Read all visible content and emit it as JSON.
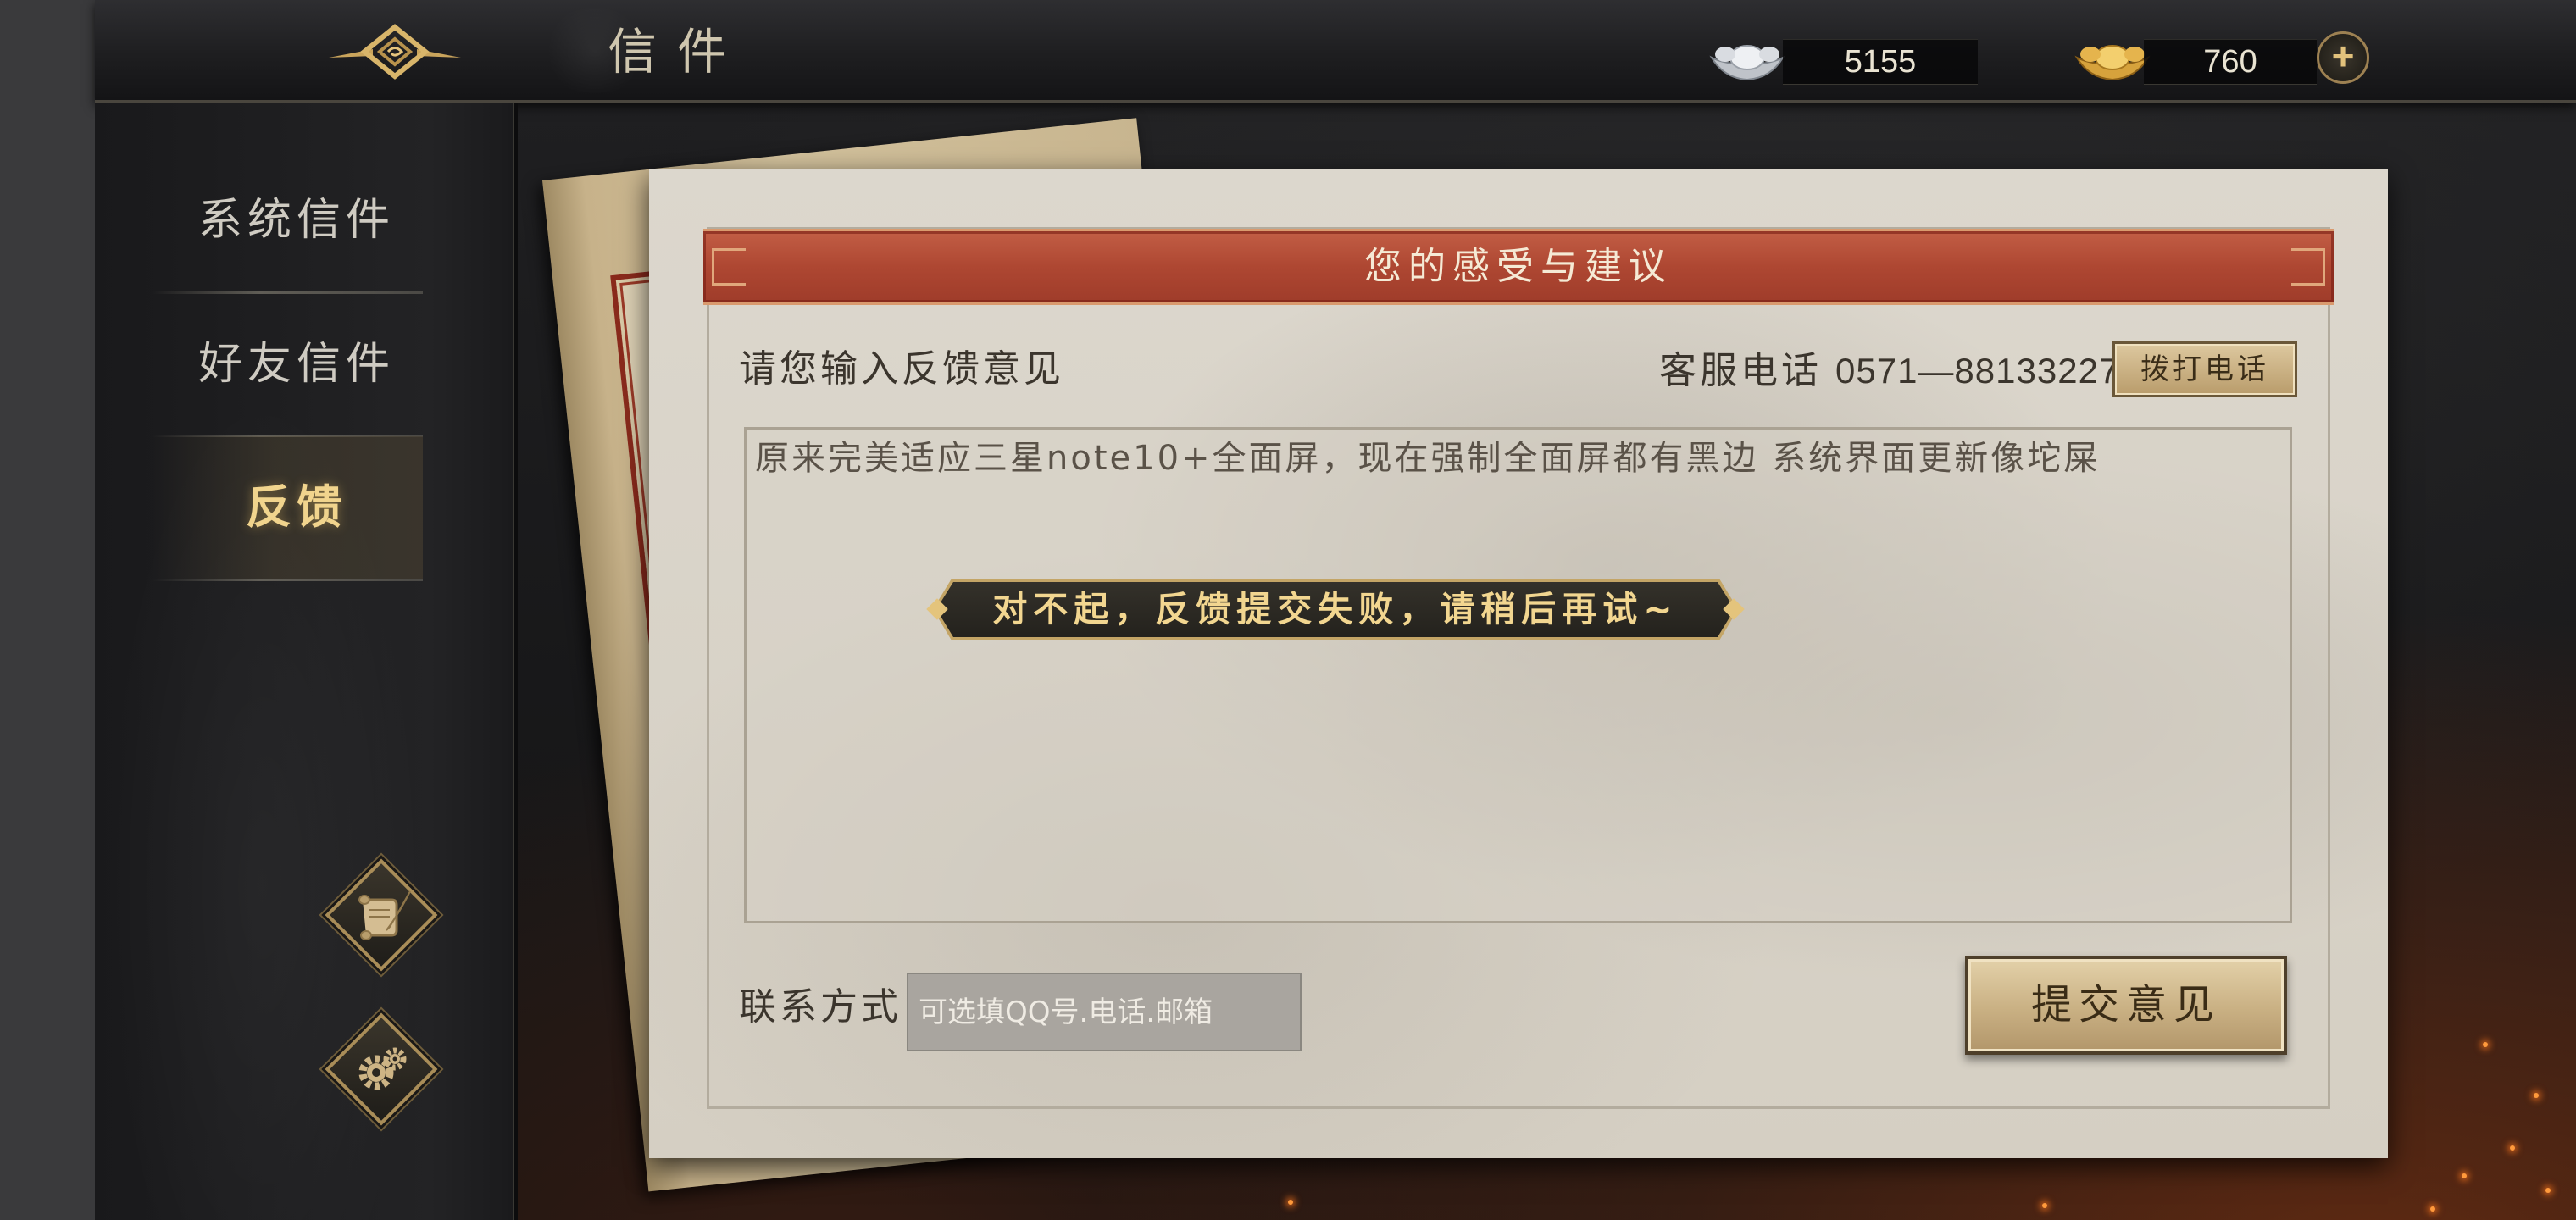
{
  "header": {
    "title": "信件",
    "back_icon": "emblem-back-icon",
    "silver": {
      "icon": "silver-ingot-icon",
      "amount": "5155"
    },
    "gold": {
      "icon": "gold-ingot-icon",
      "amount": "760"
    },
    "add_icon": "plus-icon",
    "add_label": "+"
  },
  "sidebar": {
    "items": [
      {
        "label": "系统信件",
        "selected": false
      },
      {
        "label": "好友信件",
        "selected": false
      },
      {
        "label": "反馈",
        "selected": true
      }
    ],
    "tools": [
      {
        "icon": "scroll-quill-icon"
      },
      {
        "icon": "gear-icon"
      }
    ]
  },
  "feedback": {
    "heading": "您的感受与建议",
    "prompt": "请您输入反馈意见",
    "hotline_label": "客服电话",
    "hotline_number": "0571—88133227",
    "call_button": "拨打电话",
    "text_value": "原来完美适应三星note10+全面屏，现在强制全面屏都有黑边 系统界面更新像坨屎",
    "contact_label": "联系方式",
    "contact_placeholder": "可选填QQ号.电话.邮箱",
    "submit_button": "提交意见"
  },
  "toast": {
    "message": "对不起，反馈提交失败，请稍后再试~"
  },
  "colors": {
    "accent_gold": "#f1d48d",
    "header_red": "#ae4732",
    "toast_text": "#f2d690",
    "parchment": "#d8d2c6"
  }
}
